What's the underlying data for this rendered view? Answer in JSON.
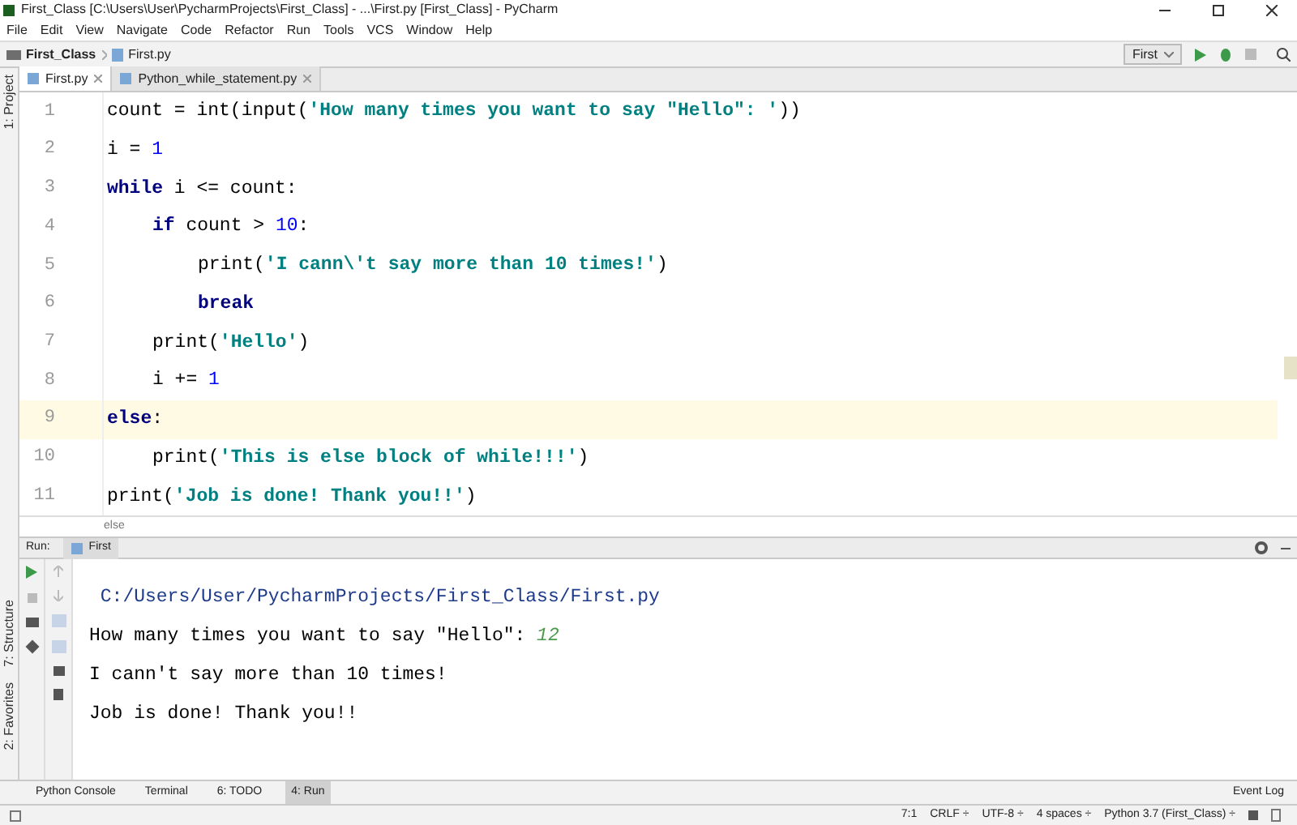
{
  "window": {
    "title": "First_Class [C:\\Users\\User\\PycharmProjects\\First_Class] - ...\\First.py [First_Class] - PyCharm"
  },
  "menu": [
    "File",
    "Edit",
    "View",
    "Navigate",
    "Code",
    "Refactor",
    "Run",
    "Tools",
    "VCS",
    "Window",
    "Help"
  ],
  "breadcrumb": [
    "First_Class",
    "First.py"
  ],
  "run_config": "First",
  "side_tools": [
    "1: Project",
    "7: Structure",
    "2: Favorites"
  ],
  "tabs": [
    {
      "label": "First.py",
      "selected": true
    },
    {
      "label": "Python_while_statement.py",
      "selected": false
    }
  ],
  "code_lines": [
    {
      "number": "1",
      "current": false,
      "tokens": [
        {
          "kind": "plain",
          "text": "count = int(input("
        },
        {
          "kind": "string",
          "text": "'How many times you want to say \"Hello\": '"
        },
        {
          "kind": "plain",
          "text": "))"
        }
      ]
    },
    {
      "number": "2",
      "current": false,
      "tokens": [
        {
          "kind": "plain",
          "text": "i = "
        },
        {
          "kind": "number",
          "text": "1"
        }
      ]
    },
    {
      "number": "3",
      "current": false,
      "tokens": [
        {
          "kind": "keyword",
          "text": "while"
        },
        {
          "kind": "plain",
          "text": " i <= count:"
        }
      ],
      "children": [
        {
          "number": "4",
          "current": false,
          "tokens": [
            {
              "kind": "keyword",
              "text": "if"
            },
            {
              "kind": "plain",
              "text": " count > "
            },
            {
              "kind": "number",
              "text": "10"
            },
            {
              "kind": "plain",
              "text": ":"
            }
          ],
          "children": [
            {
              "number": "5",
              "current": false,
              "tokens": [
                {
                  "kind": "plain",
                  "text": "print("
                },
                {
                  "kind": "string",
                  "text": "'I cann\\'t say more than 10 times!'"
                },
                {
                  "kind": "plain",
                  "text": ")"
                }
              ]
            },
            {
              "number": "6",
              "current": false,
              "tokens": [
                {
                  "kind": "keyword",
                  "text": "break"
                }
              ]
            }
          ]
        },
        {
          "number": "7",
          "current": false,
          "tokens": [
            {
              "kind": "plain",
              "text": "print("
            },
            {
              "kind": "string",
              "text": "'Hello'"
            },
            {
              "kind": "plain",
              "text": ")"
            }
          ]
        },
        {
          "number": "8",
          "current": false,
          "tokens": [
            {
              "kind": "plain",
              "text": "i += "
            },
            {
              "kind": "number",
              "text": "1"
            }
          ]
        }
      ]
    },
    {
      "number": "9",
      "current": true,
      "tokens": [
        {
          "kind": "keyword",
          "text": "else"
        },
        {
          "kind": "plain",
          "text": ":"
        }
      ],
      "children": [
        {
          "number": "10",
          "current": false,
          "tokens": [
            {
              "kind": "plain",
              "text": "print("
            },
            {
              "kind": "string",
              "text": "'This is else block of while!!!'"
            },
            {
              "kind": "plain",
              "text": ")"
            }
          ]
        }
      ]
    },
    {
      "number": "11",
      "current": false,
      "tokens": [
        {
          "kind": "plain",
          "text": "print("
        },
        {
          "kind": "string",
          "text": "'Job is done! Thank you!!'"
        },
        {
          "kind": "plain",
          "text": ")"
        }
      ]
    }
  ],
  "editor_breadcrumb": "else",
  "run_panel": {
    "label": "Run:",
    "tab": "First",
    "output": [
      {
        "kind": "path",
        "text": " C:/Users/User/PycharmProjects/First_Class/First.py"
      },
      {
        "kind": "prompt",
        "text": "How many times you want to say \"Hello\": ",
        "input": "12"
      },
      {
        "kind": "plain",
        "text": "I cann't say more than 10 times!"
      },
      {
        "kind": "plain",
        "text": "Job is done! Thank you!!"
      }
    ]
  },
  "tool_tabs": [
    {
      "label": "Python Console",
      "selected": false
    },
    {
      "label": "Terminal",
      "selected": false
    },
    {
      "label": "6: TODO",
      "selected": false
    },
    {
      "label": "4: Run",
      "selected": true
    }
  ],
  "event_log": "Event Log",
  "status_bar": [
    "7:1",
    "CRLF ÷",
    "UTF-8 ÷",
    "4 spaces ÷",
    "Python 3.7 (First_Class) ÷"
  ]
}
